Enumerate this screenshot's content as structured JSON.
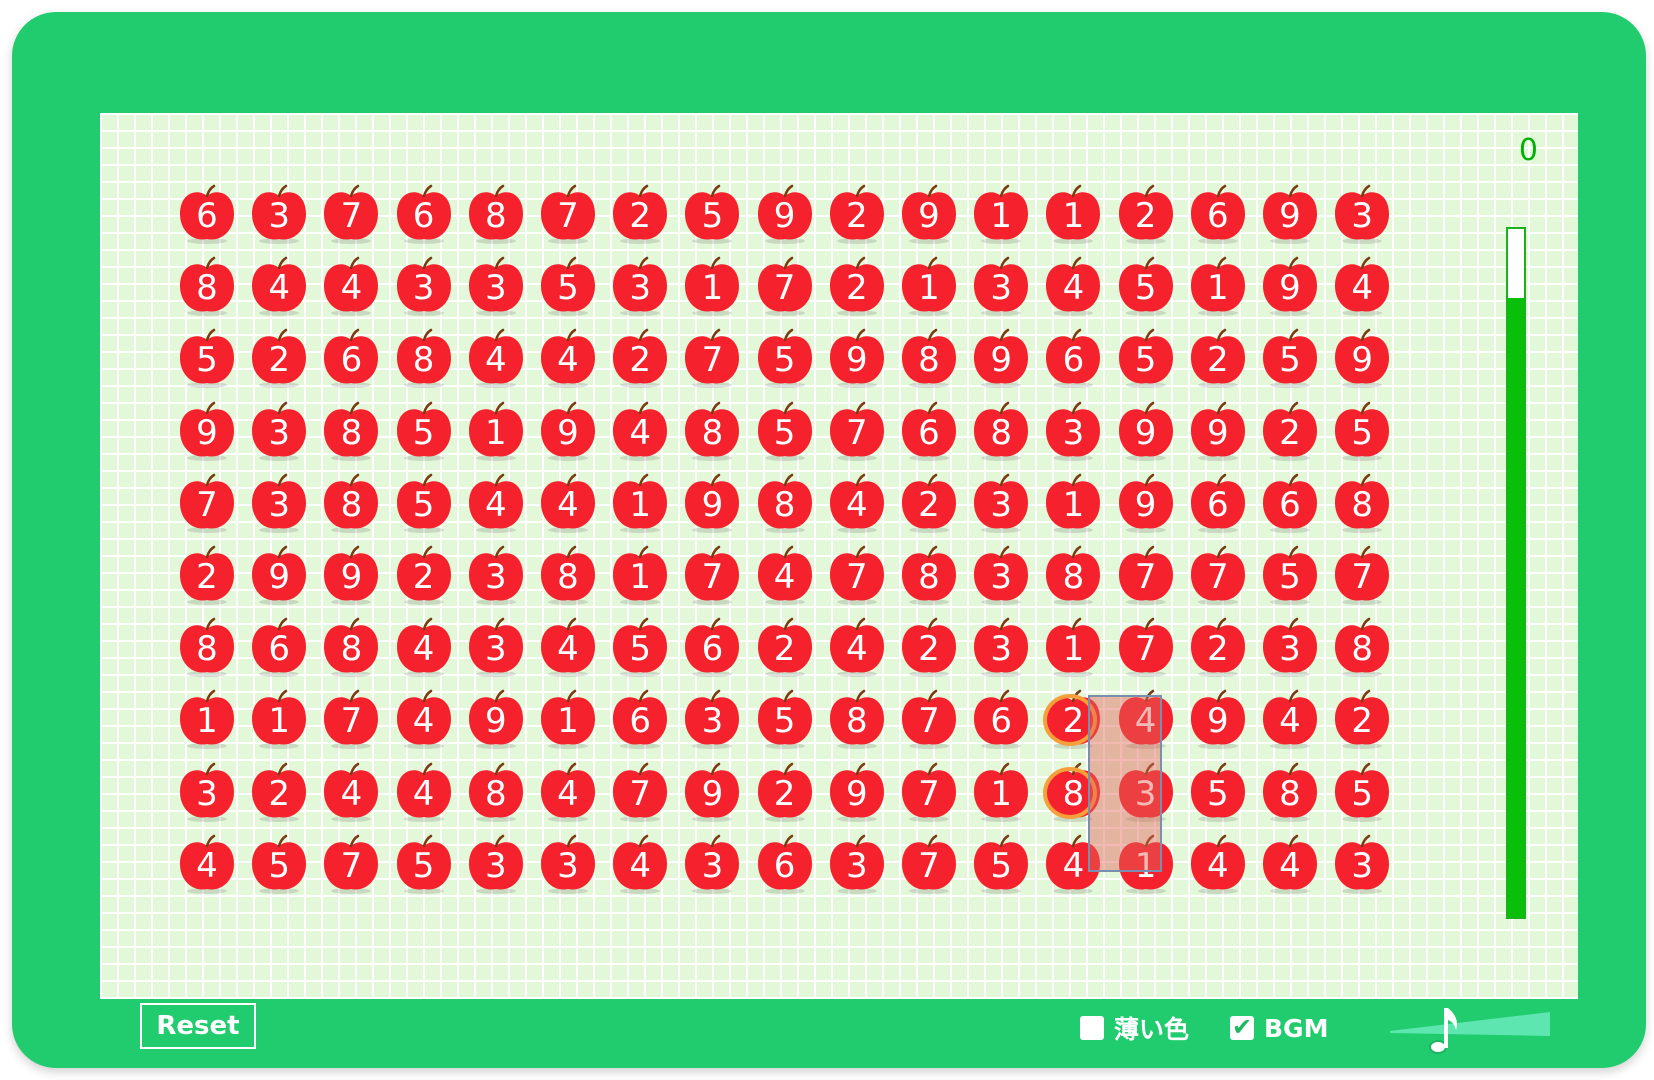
{
  "score": "0",
  "timer_fraction": 0.9,
  "reset_label": "Reset",
  "options": {
    "light_color": {
      "label": "薄い色",
      "checked": false
    },
    "bgm": {
      "label": "BGM",
      "checked": true
    }
  },
  "colors": {
    "frame": "#20cc6e",
    "board": "#e3f7d9",
    "apple": "#f5222d",
    "timer": "#0abf0a",
    "score": "#00b300"
  },
  "icons": {
    "volume": "music-note-icon"
  },
  "grid": [
    [
      6,
      3,
      7,
      6,
      8,
      7,
      2,
      5,
      9,
      2,
      9,
      1,
      1,
      2,
      6,
      9,
      3
    ],
    [
      8,
      4,
      4,
      3,
      3,
      5,
      3,
      1,
      7,
      2,
      1,
      3,
      4,
      5,
      1,
      9,
      4
    ],
    [
      5,
      2,
      6,
      8,
      4,
      4,
      2,
      7,
      5,
      9,
      8,
      9,
      6,
      5,
      2,
      5,
      9
    ],
    [
      9,
      3,
      8,
      5,
      1,
      9,
      4,
      8,
      5,
      7,
      6,
      8,
      3,
      9,
      9,
      2,
      5
    ],
    [
      7,
      3,
      8,
      5,
      4,
      4,
      1,
      9,
      8,
      4,
      2,
      3,
      1,
      9,
      6,
      6,
      8
    ],
    [
      2,
      9,
      9,
      2,
      3,
      8,
      1,
      7,
      4,
      7,
      8,
      3,
      8,
      7,
      7,
      5,
      7
    ],
    [
      8,
      6,
      8,
      4,
      3,
      4,
      5,
      6,
      2,
      4,
      2,
      3,
      1,
      7,
      2,
      3,
      8
    ],
    [
      1,
      1,
      7,
      4,
      9,
      1,
      6,
      3,
      5,
      8,
      7,
      6,
      2,
      4,
      9,
      4,
      2
    ],
    [
      3,
      2,
      4,
      4,
      8,
      4,
      7,
      9,
      2,
      9,
      7,
      1,
      8,
      3,
      5,
      8,
      5
    ],
    [
      4,
      5,
      7,
      5,
      3,
      3,
      4,
      3,
      6,
      3,
      7,
      5,
      4,
      1,
      4,
      4,
      3
    ]
  ],
  "selected_cells": [
    [
      7,
      12
    ],
    [
      8,
      12
    ]
  ]
}
